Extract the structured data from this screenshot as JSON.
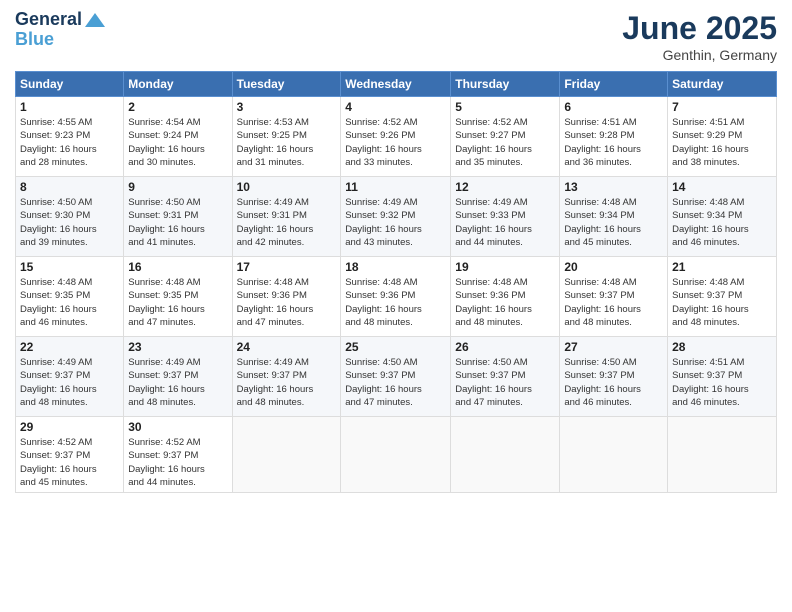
{
  "header": {
    "logo_line1": "General",
    "logo_line2": "Blue",
    "month": "June 2025",
    "location": "Genthin, Germany"
  },
  "weekdays": [
    "Sunday",
    "Monday",
    "Tuesday",
    "Wednesday",
    "Thursday",
    "Friday",
    "Saturday"
  ],
  "weeks": [
    [
      {
        "day": "1",
        "info": "Sunrise: 4:55 AM\nSunset: 9:23 PM\nDaylight: 16 hours\nand 28 minutes."
      },
      {
        "day": "2",
        "info": "Sunrise: 4:54 AM\nSunset: 9:24 PM\nDaylight: 16 hours\nand 30 minutes."
      },
      {
        "day": "3",
        "info": "Sunrise: 4:53 AM\nSunset: 9:25 PM\nDaylight: 16 hours\nand 31 minutes."
      },
      {
        "day": "4",
        "info": "Sunrise: 4:52 AM\nSunset: 9:26 PM\nDaylight: 16 hours\nand 33 minutes."
      },
      {
        "day": "5",
        "info": "Sunrise: 4:52 AM\nSunset: 9:27 PM\nDaylight: 16 hours\nand 35 minutes."
      },
      {
        "day": "6",
        "info": "Sunrise: 4:51 AM\nSunset: 9:28 PM\nDaylight: 16 hours\nand 36 minutes."
      },
      {
        "day": "7",
        "info": "Sunrise: 4:51 AM\nSunset: 9:29 PM\nDaylight: 16 hours\nand 38 minutes."
      }
    ],
    [
      {
        "day": "8",
        "info": "Sunrise: 4:50 AM\nSunset: 9:30 PM\nDaylight: 16 hours\nand 39 minutes."
      },
      {
        "day": "9",
        "info": "Sunrise: 4:50 AM\nSunset: 9:31 PM\nDaylight: 16 hours\nand 41 minutes."
      },
      {
        "day": "10",
        "info": "Sunrise: 4:49 AM\nSunset: 9:31 PM\nDaylight: 16 hours\nand 42 minutes."
      },
      {
        "day": "11",
        "info": "Sunrise: 4:49 AM\nSunset: 9:32 PM\nDaylight: 16 hours\nand 43 minutes."
      },
      {
        "day": "12",
        "info": "Sunrise: 4:49 AM\nSunset: 9:33 PM\nDaylight: 16 hours\nand 44 minutes."
      },
      {
        "day": "13",
        "info": "Sunrise: 4:48 AM\nSunset: 9:34 PM\nDaylight: 16 hours\nand 45 minutes."
      },
      {
        "day": "14",
        "info": "Sunrise: 4:48 AM\nSunset: 9:34 PM\nDaylight: 16 hours\nand 46 minutes."
      }
    ],
    [
      {
        "day": "15",
        "info": "Sunrise: 4:48 AM\nSunset: 9:35 PM\nDaylight: 16 hours\nand 46 minutes."
      },
      {
        "day": "16",
        "info": "Sunrise: 4:48 AM\nSunset: 9:35 PM\nDaylight: 16 hours\nand 47 minutes."
      },
      {
        "day": "17",
        "info": "Sunrise: 4:48 AM\nSunset: 9:36 PM\nDaylight: 16 hours\nand 47 minutes."
      },
      {
        "day": "18",
        "info": "Sunrise: 4:48 AM\nSunset: 9:36 PM\nDaylight: 16 hours\nand 48 minutes."
      },
      {
        "day": "19",
        "info": "Sunrise: 4:48 AM\nSunset: 9:36 PM\nDaylight: 16 hours\nand 48 minutes."
      },
      {
        "day": "20",
        "info": "Sunrise: 4:48 AM\nSunset: 9:37 PM\nDaylight: 16 hours\nand 48 minutes."
      },
      {
        "day": "21",
        "info": "Sunrise: 4:48 AM\nSunset: 9:37 PM\nDaylight: 16 hours\nand 48 minutes."
      }
    ],
    [
      {
        "day": "22",
        "info": "Sunrise: 4:49 AM\nSunset: 9:37 PM\nDaylight: 16 hours\nand 48 minutes."
      },
      {
        "day": "23",
        "info": "Sunrise: 4:49 AM\nSunset: 9:37 PM\nDaylight: 16 hours\nand 48 minutes."
      },
      {
        "day": "24",
        "info": "Sunrise: 4:49 AM\nSunset: 9:37 PM\nDaylight: 16 hours\nand 48 minutes."
      },
      {
        "day": "25",
        "info": "Sunrise: 4:50 AM\nSunset: 9:37 PM\nDaylight: 16 hours\nand 47 minutes."
      },
      {
        "day": "26",
        "info": "Sunrise: 4:50 AM\nSunset: 9:37 PM\nDaylight: 16 hours\nand 47 minutes."
      },
      {
        "day": "27",
        "info": "Sunrise: 4:50 AM\nSunset: 9:37 PM\nDaylight: 16 hours\nand 46 minutes."
      },
      {
        "day": "28",
        "info": "Sunrise: 4:51 AM\nSunset: 9:37 PM\nDaylight: 16 hours\nand 46 minutes."
      }
    ],
    [
      {
        "day": "29",
        "info": "Sunrise: 4:52 AM\nSunset: 9:37 PM\nDaylight: 16 hours\nand 45 minutes."
      },
      {
        "day": "30",
        "info": "Sunrise: 4:52 AM\nSunset: 9:37 PM\nDaylight: 16 hours\nand 44 minutes."
      },
      null,
      null,
      null,
      null,
      null
    ]
  ]
}
